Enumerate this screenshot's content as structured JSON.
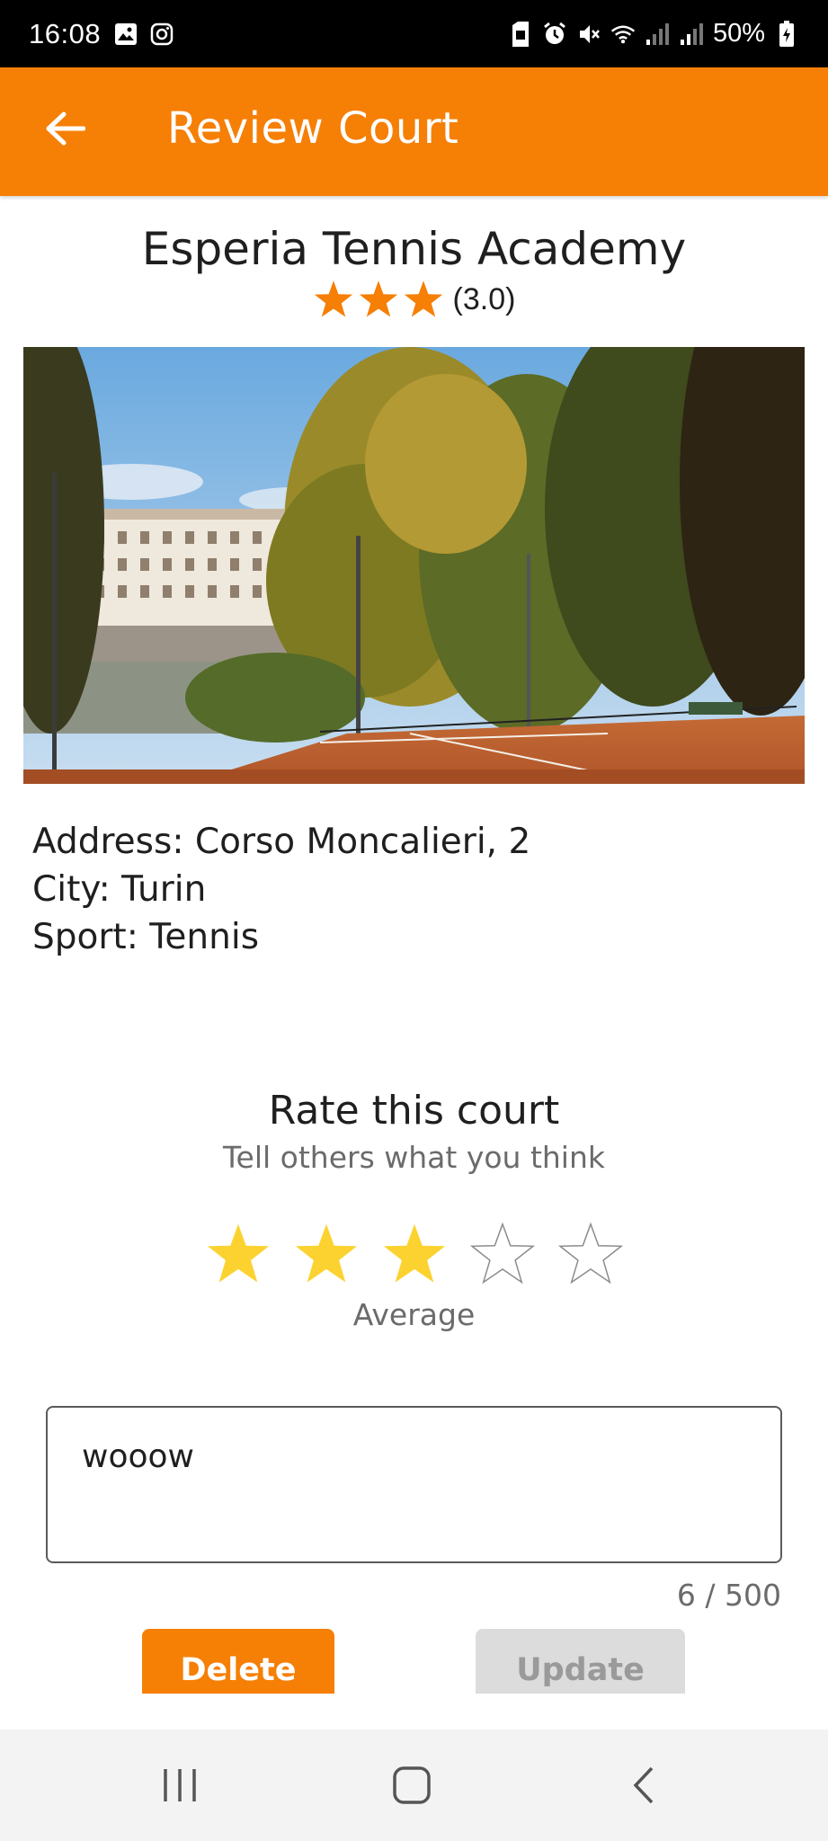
{
  "status_bar": {
    "time": "16:08",
    "battery": "50%",
    "left_icons": [
      "gallery-icon",
      "instagram-icon"
    ],
    "right_icons": [
      "sim-icon",
      "alarm-icon",
      "mute-icon",
      "wifi-icon",
      "signal-icon",
      "signal-icon",
      "battery-charging-icon"
    ]
  },
  "app_bar": {
    "title": "Review Court",
    "back_icon": "arrow-left-icon",
    "color": "#f67f06"
  },
  "court": {
    "name": "Esperia Tennis Academy",
    "rating_value": "(3.0)",
    "rating_stars": 3,
    "address": "Address: Corso Moncalieri, 2",
    "city": "City: Turin",
    "sport": "Sport: Tennis"
  },
  "rate": {
    "title": "Rate this court",
    "subtitle": "Tell others what you think",
    "selected_stars": 3,
    "max_stars": 5,
    "label": "Average",
    "star_color": "#fcd230"
  },
  "review": {
    "value": "wooow",
    "char_count": "6 / 500"
  },
  "buttons": {
    "delete_label": "Delete",
    "update_label": "Update"
  },
  "nav_bar": {
    "recent_icon": "recent-apps-icon",
    "home_icon": "home-icon",
    "back_icon": "back-icon"
  }
}
